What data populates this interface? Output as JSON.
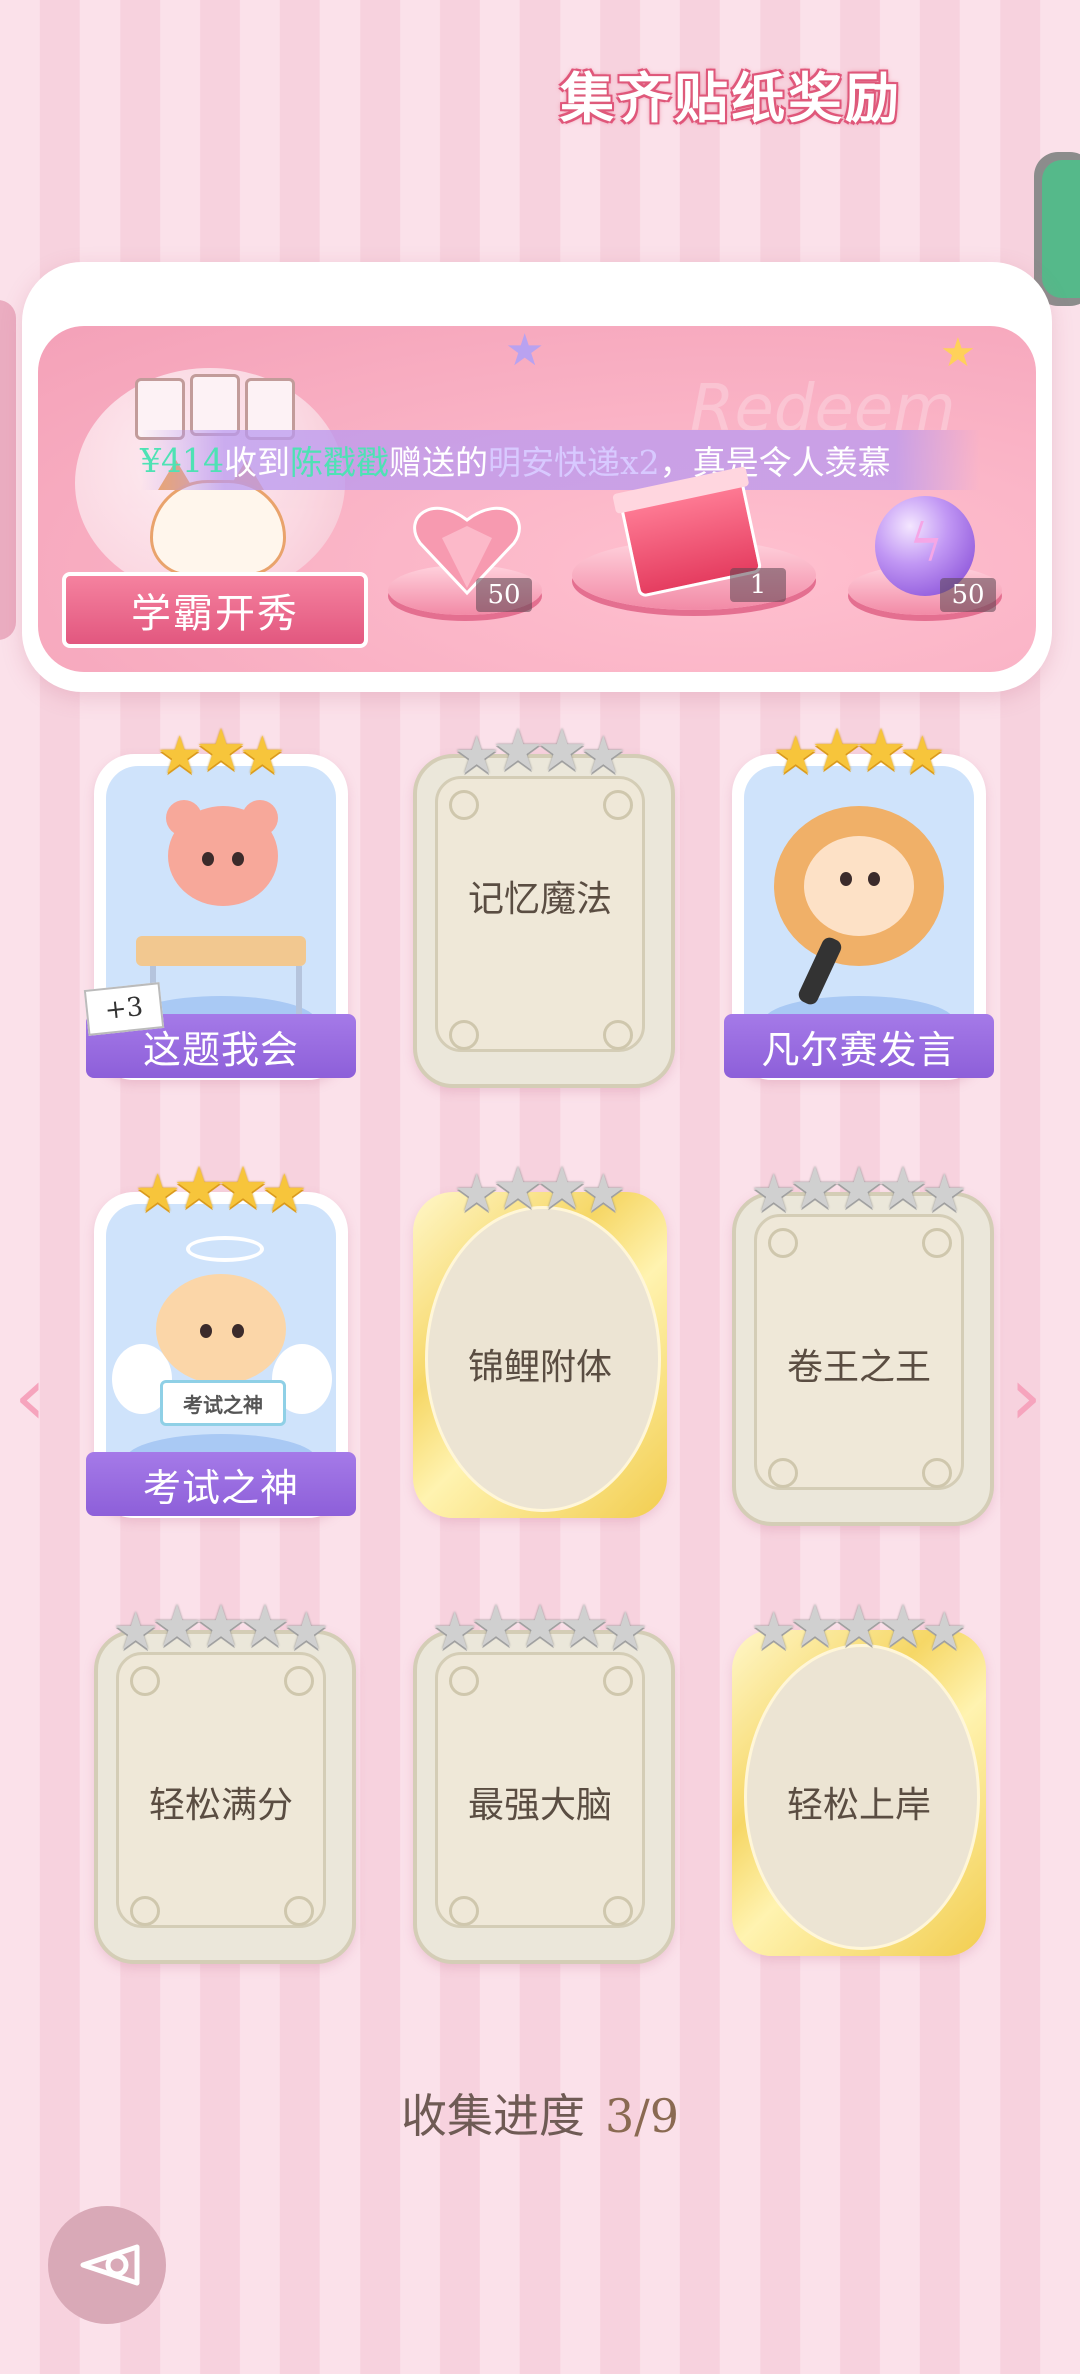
{
  "banner": {
    "title": "集齐贴纸奖励",
    "watermark": "Redeem",
    "ribbon_label": "学霸开秀",
    "ticker": {
      "prefix": "¥414",
      "mid1": "收到",
      "name": "陈戳戳",
      "mid2": "赠送的",
      "gift": "明安快递x2",
      "suffix": "，真是令人羡慕"
    },
    "rewards": [
      {
        "icon": "heart-gem-icon",
        "count": "50"
      },
      {
        "icon": "gift-box-icon",
        "count": "1"
      },
      {
        "icon": "lightning-orb-icon",
        "count": "50"
      }
    ]
  },
  "cards": [
    {
      "name": "这题我会",
      "stars_filled": 3,
      "stars_total": 3,
      "unlocked": true,
      "badge": "+3"
    },
    {
      "name": "记忆魔法",
      "stars_filled": 0,
      "stars_total": 4,
      "unlocked": false
    },
    {
      "name": "凡尔赛发言",
      "stars_filled": 4,
      "stars_total": 4,
      "unlocked": true
    },
    {
      "name": "考试之神",
      "stars_filled": 4,
      "stars_total": 4,
      "unlocked": true,
      "sign": "考试之神"
    },
    {
      "name": "锦鲤附体",
      "stars_filled": 0,
      "stars_total": 4,
      "unlocked": false,
      "frame": "gold"
    },
    {
      "name": "卷王之王",
      "stars_filled": 0,
      "stars_total": 5,
      "unlocked": false
    },
    {
      "name": "轻松满分",
      "stars_filled": 0,
      "stars_total": 5,
      "unlocked": false
    },
    {
      "name": "最强大脑",
      "stars_filled": 0,
      "stars_total": 5,
      "unlocked": false
    },
    {
      "name": "轻松上岸",
      "stars_filled": 0,
      "stars_total": 5,
      "unlocked": false,
      "frame": "gold"
    }
  ],
  "progress": {
    "label": "收集进度",
    "value": "3/9"
  },
  "nav": {
    "prev": "‹",
    "next": "›"
  },
  "colors": {
    "background_stripe_a": "#fbe1ea",
    "background_stripe_b": "#f7d2de",
    "name_bar": "#9a6be2",
    "gold_star": "#f7c53b",
    "grey_star": "#d0d0d0"
  }
}
